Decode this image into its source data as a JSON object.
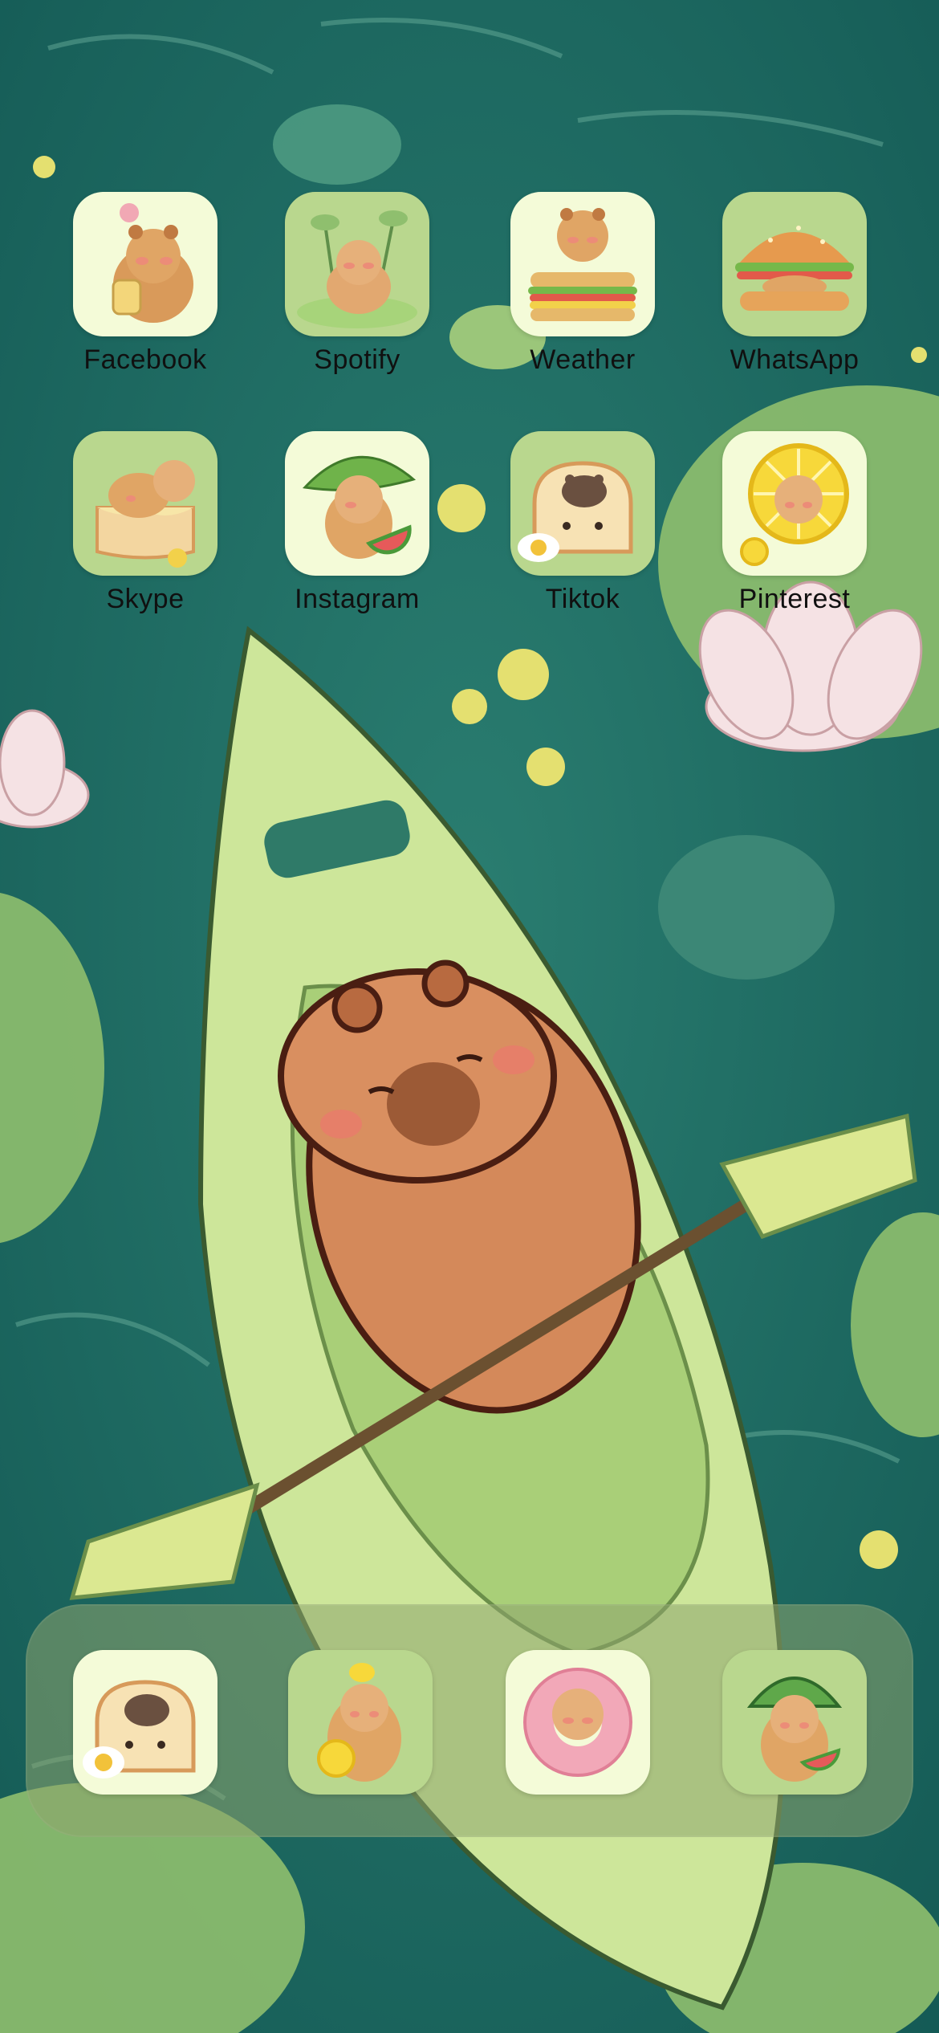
{
  "home_screen": {
    "apps": [
      {
        "label": "Facebook",
        "icon": "capybara-honey-jar-icon",
        "tile": "#f4fbd8"
      },
      {
        "label": "Spotify",
        "icon": "capybara-lotus-seeds-icon",
        "tile": "#b9d78e"
      },
      {
        "label": "Weather",
        "icon": "capybara-sandwich-icon",
        "tile": "#f4fbd8"
      },
      {
        "label": "WhatsApp",
        "icon": "capybara-burger-icon",
        "tile": "#b9d78e"
      },
      {
        "label": "Skype",
        "icon": "capybara-toast-icon",
        "tile": "#b9d78e"
      },
      {
        "label": "Instagram",
        "icon": "capybara-leaf-watermelon-icon",
        "tile": "#f4fbd8"
      },
      {
        "label": "Tiktok",
        "icon": "capybara-bread-egg-icon",
        "tile": "#b9d78e"
      },
      {
        "label": "Pinterest",
        "icon": "capybara-lemon-slice-icon",
        "tile": "#f4fbd8"
      }
    ],
    "dock": [
      {
        "icon": "capybara-bread-egg-icon",
        "tile": "#f4fbd8"
      },
      {
        "icon": "capybara-lemon-icon",
        "tile": "#b9d78e"
      },
      {
        "icon": "capybara-swim-ring-icon",
        "tile": "#f4fbd8"
      },
      {
        "icon": "capybara-watermelon-hat-icon",
        "tile": "#b9d78e"
      }
    ]
  },
  "wallpaper": {
    "subject": "capybara-kayak-wallpaper",
    "colors": {
      "water": "#1f6f66",
      "kayak": "#cde69a",
      "capybara": "#d4895a",
      "lily": "#9cc77a"
    }
  }
}
